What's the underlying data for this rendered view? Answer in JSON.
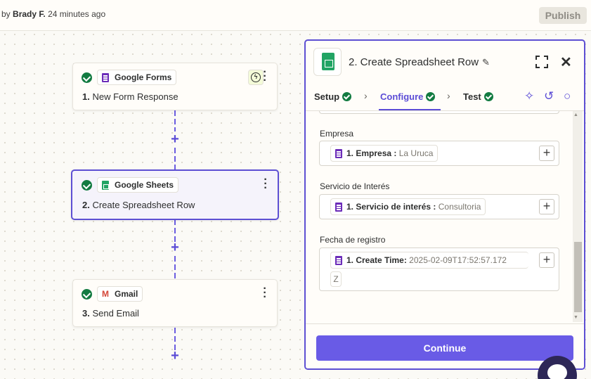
{
  "topbar": {
    "by_prefix": "by",
    "author": "Brady F.",
    "time_ago": "24 minutes ago",
    "publish_label": "Publish"
  },
  "steps": [
    {
      "app": "Google Forms",
      "number": "1.",
      "title": "New Form Response"
    },
    {
      "app": "Google Sheets",
      "number": "2.",
      "title": "Create Spreadsheet Row"
    },
    {
      "app": "Gmail",
      "number": "3.",
      "title": "Send Email"
    }
  ],
  "panel": {
    "title": "2. Create Spreadsheet Row",
    "tabs": {
      "setup": "Setup",
      "configure": "Configure",
      "test": "Test"
    },
    "fields": [
      {
        "label": "Empresa",
        "token": "1. Empresa :",
        "value": "La Uruca"
      },
      {
        "label": "Servicio de Interés",
        "token": "1. Servicio de interés :",
        "value": "Consultoria"
      },
      {
        "label": "Fecha de registro",
        "token": "1. Create Time:",
        "value": "2025-02-09T17:52:57.172",
        "value_cont": "Z"
      }
    ],
    "continue_label": "Continue"
  },
  "icons": {
    "forms": "google-forms-icon",
    "sheets": "google-sheets-icon",
    "gmail": "gmail-icon",
    "trigger": "bolt-icon"
  },
  "colors": {
    "accent": "#5d4fd3",
    "success": "#127b41",
    "button": "#695be6"
  }
}
